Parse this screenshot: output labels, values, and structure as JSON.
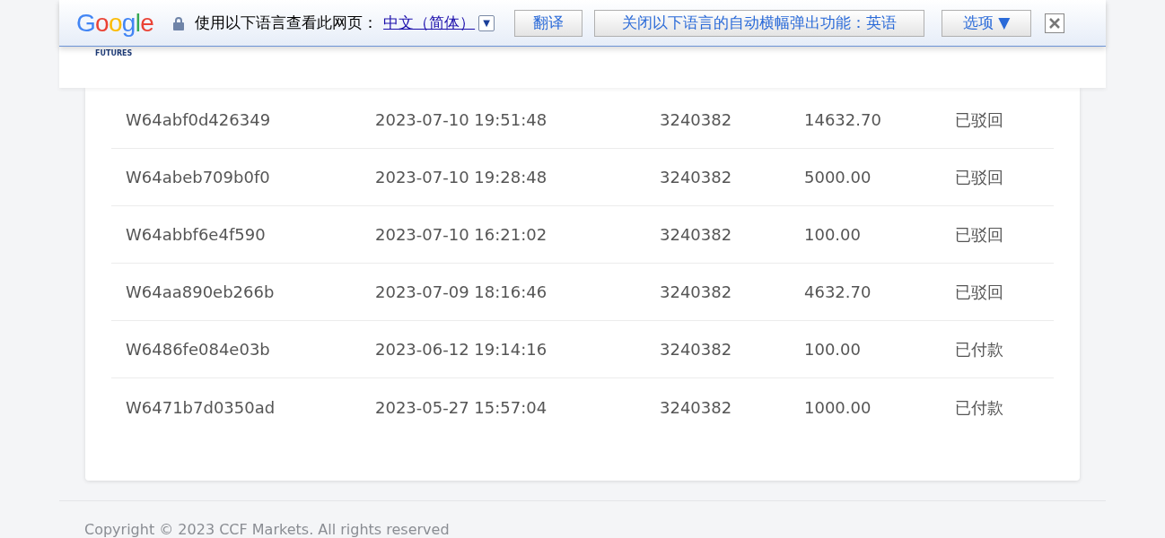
{
  "translate_bar": {
    "logo": "Google",
    "prompt": "使用以下语言查看此网页：",
    "language": "中文（简体）",
    "dropdown": "▼",
    "translate_button": "翻译",
    "never_button": "关闭以下语言的自动横幅弹出功能：英语",
    "options_button": "选项 ▼"
  },
  "header": {
    "logo_text": "FUTURES"
  },
  "rows": [
    {
      "id": "W64abf0d426349",
      "time": "2023-07-10 19:51:48",
      "account": "3240382",
      "amount": "14632.70",
      "status": "已驳回"
    },
    {
      "id": "W64abeb709b0f0",
      "time": "2023-07-10 19:28:48",
      "account": "3240382",
      "amount": "5000.00",
      "status": "已驳回"
    },
    {
      "id": "W64abbf6e4f590",
      "time": "2023-07-10 16:21:02",
      "account": "3240382",
      "amount": "100.00",
      "status": "已驳回"
    },
    {
      "id": "W64aa890eb266b",
      "time": "2023-07-09 18:16:46",
      "account": "3240382",
      "amount": "4632.70",
      "status": "已驳回"
    },
    {
      "id": "W6486fe084e03b",
      "time": "2023-06-12 19:14:16",
      "account": "3240382",
      "amount": "100.00",
      "status": "已付款"
    },
    {
      "id": "W6471b7d0350ad",
      "time": "2023-05-27 15:57:04",
      "account": "3240382",
      "amount": "1000.00",
      "status": "已付款"
    }
  ],
  "footer": {
    "copyright": "Copyright © 2023 CCF Markets. All rights reserved"
  }
}
